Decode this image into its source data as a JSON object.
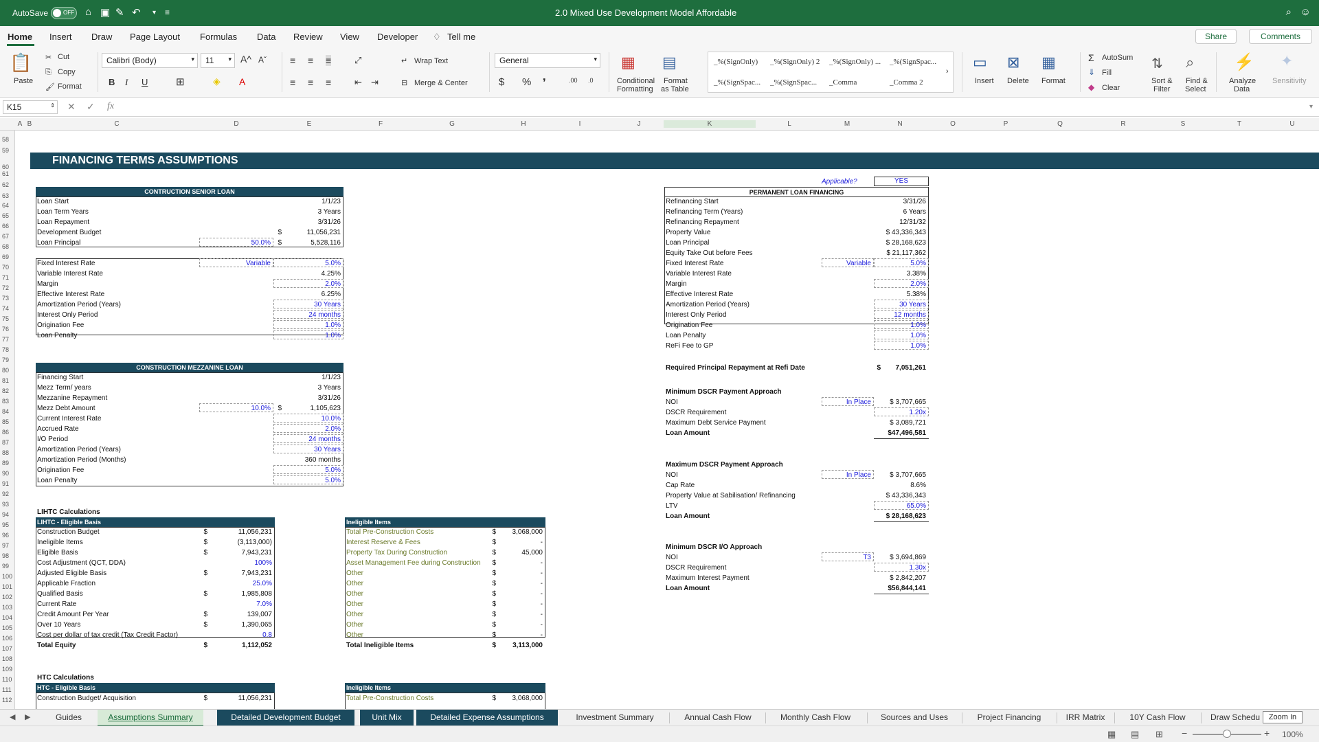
{
  "title_bar": {
    "autosave_label": "AutoSave",
    "toggle_label": "OFF",
    "doc_title": "2.0 Mixed Use Development Model Affordable"
  },
  "menu": {
    "items": [
      "Home",
      "Insert",
      "Draw",
      "Page Layout",
      "Formulas",
      "Data",
      "Review",
      "View",
      "Developer"
    ],
    "tell_me": "Tell me",
    "share": "Share",
    "comments": "Comments"
  },
  "ribbon": {
    "paste": "Paste",
    "cut": "Cut",
    "copy": "Copy",
    "format_painter": "Format",
    "font_name": "Calibri (Body)",
    "font_size": "11",
    "wrap_text": "Wrap Text",
    "merge_center": "Merge & Center",
    "number_format": "General",
    "conditional_formatting": [
      "Conditional",
      "Formatting"
    ],
    "format_as_table": [
      "Format",
      "as Table"
    ],
    "styles": [
      "_%(SignOnly)",
      "_%(SignOnly) 2",
      "_%(SignOnly) ...",
      "_%(SignSpac...",
      "_%(SignSpac...",
      "_%(SignSpac...",
      "_Comma",
      "_Comma 2"
    ],
    "insert": "Insert",
    "delete": "Delete",
    "format": "Format",
    "autosum": "AutoSum",
    "fill": "Fill",
    "clear": "Clear",
    "sort_filter": [
      "Sort &",
      "Filter"
    ],
    "find_select": [
      "Find &",
      "Select"
    ],
    "analyze_data": [
      "Analyze",
      "Data"
    ],
    "sensitivity": "Sensitivity"
  },
  "formula_bar": {
    "cell_ref": "K15",
    "fx": "fx"
  },
  "columns": [
    "A",
    "B",
    "C",
    "D",
    "E",
    "F",
    "G",
    "H",
    "I",
    "J",
    "K",
    "L",
    "M",
    "N",
    "O",
    "P",
    "Q",
    "R",
    "S",
    "T",
    "U"
  ],
  "rows": [
    "58",
    "59",
    "60",
    "61",
    "62",
    "63",
    "64",
    "65",
    "66",
    "67",
    "68",
    "69",
    "70",
    "71",
    "72",
    "73",
    "74",
    "75",
    "76",
    "77",
    "78",
    "79",
    "80",
    "81",
    "82",
    "83",
    "84",
    "85",
    "86",
    "87",
    "88",
    "89",
    "90",
    "91",
    "92",
    "93",
    "94",
    "95",
    "96",
    "97",
    "98",
    "99",
    "100",
    "101",
    "102",
    "103",
    "104",
    "105",
    "106",
    "107",
    "108",
    "109",
    "110",
    "111",
    "112"
  ],
  "banner": "FINANCING TERMS ASSUMPTIONS",
  "senior_loan": {
    "title": "CONTRUCTION SENIOR LOAN",
    "rows": [
      {
        "label": "Loan Start",
        "value": "1/1/23"
      },
      {
        "label": "Loan Term Years",
        "value": "3 Years"
      },
      {
        "label": "Loan Repayment",
        "value": "3/31/26"
      },
      {
        "label": "Development Budget",
        "value": "11,056,231"
      },
      {
        "label": "Loan Principal",
        "value": "5,528,116"
      }
    ],
    "dollar": "$",
    "pct": "50.0%",
    "rows2": [
      {
        "label": "Fixed Interest Rate",
        "value": "5.0%"
      },
      {
        "label": "Variable Interest Rate",
        "value": "4.25%"
      },
      {
        "label": "Margin",
        "value": "2.0%"
      },
      {
        "label": "Effective Interest Rate",
        "value": "6.25%"
      },
      {
        "label": "Amortization Period (Years)",
        "value": "30 Years"
      },
      {
        "label": "Interest Only Period",
        "value": "24 months"
      },
      {
        "label": "Origination Fee",
        "value": "1.0%"
      },
      {
        "label": "Loan Penalty",
        "value": "1.0%"
      }
    ],
    "variable": "Variable"
  },
  "mezz_loan": {
    "title": "CONSTRUCTION MEZZANINE LOAN",
    "rows": [
      {
        "label": "Financing Start",
        "value": "1/1/23"
      },
      {
        "label": "Mezz Term/ years",
        "value": "3 Years"
      },
      {
        "label": "Mezzanine Repayment",
        "value": "3/31/26"
      },
      {
        "label": "Mezz Debt Amount",
        "value": "1,105,623"
      },
      {
        "label": "Current Interest Rate",
        "value": "10.0%"
      },
      {
        "label": "Accrued Rate",
        "value": "2.0%"
      },
      {
        "label": "I/O Period",
        "value": "24 months"
      },
      {
        "label": "Amortization Period (Years)",
        "value": "30 Years"
      },
      {
        "label": "Amortization Period (Months)",
        "value": "360 months"
      },
      {
        "label": "Origination Fee",
        "value": "5.0%"
      },
      {
        "label": "Loan Penalty",
        "value": "5.0%"
      }
    ],
    "pct": "10.0%",
    "dollar": "$"
  },
  "lihtc": {
    "heading": "LIHTC Calculations",
    "title": "LIHTC - Eligible Basis",
    "rows": [
      {
        "label": "Construction Budget",
        "dollar": "$",
        "value": "11,056,231"
      },
      {
        "label": "Ineligible Items",
        "dollar": "$",
        "value": "(3,113,000)"
      },
      {
        "label": "Eligible Basis",
        "dollar": "$",
        "value": "7,943,231"
      },
      {
        "label": "Cost Adjustment (QCT, DDA)",
        "dollar": "",
        "value": "100%"
      },
      {
        "label": "Adjusted Eligible Basis",
        "dollar": "$",
        "value": "7,943,231"
      },
      {
        "label": "Applicable Fraction",
        "dollar": "",
        "value": "25.0%"
      },
      {
        "label": "Qualified Basis",
        "dollar": "$",
        "value": "1,985,808"
      },
      {
        "label": "Current Rate",
        "dollar": "",
        "value": "7.0%"
      },
      {
        "label": "Credit Amount Per Year",
        "dollar": "$",
        "value": "139,007"
      },
      {
        "label": "Over 10 Years",
        "dollar": "$",
        "value": "1,390,065"
      },
      {
        "label": "Cost per dollar of tax credit (Tax Credit Factor)",
        "dollar": "",
        "value": "0.8"
      },
      {
        "label": "Total Equity",
        "dollar": "$",
        "value": "1,112,052"
      }
    ]
  },
  "ineligible": {
    "title": "Ineligible Items",
    "rows": [
      {
        "label": "Total Pre-Construction Costs",
        "dollar": "$",
        "value": "3,068,000"
      },
      {
        "label": "Interest Reserve & Fees",
        "dollar": "$",
        "value": "-"
      },
      {
        "label": "Property Tax During Construction",
        "dollar": "$",
        "value": "45,000"
      },
      {
        "label": "Asset Management Fee during Construction",
        "dollar": "$",
        "value": "-"
      },
      {
        "label": "Other",
        "dollar": "$",
        "value": "-"
      },
      {
        "label": "Other",
        "dollar": "$",
        "value": "-"
      },
      {
        "label": "Other",
        "dollar": "$",
        "value": "-"
      },
      {
        "label": "Other",
        "dollar": "$",
        "value": "-"
      },
      {
        "label": "Other",
        "dollar": "$",
        "value": "-"
      },
      {
        "label": "Other",
        "dollar": "$",
        "value": "-"
      },
      {
        "label": "Other",
        "dollar": "$",
        "value": "-"
      },
      {
        "label": "Total Ineligible Items",
        "dollar": "$",
        "value": "3,113,000"
      }
    ]
  },
  "htc": {
    "heading": "HTC Calculations",
    "title": "HTC - Eligible Basis",
    "row1_label": "Construction Budget/ Acquisition",
    "row1_dollar": "$",
    "row1_value": "11,056,231",
    "inel_title": "Ineligible Items",
    "inel_row1_label": "Total Pre-Construction Costs",
    "inel_row1_dollar": "$",
    "inel_row1_value": "3,068,000"
  },
  "perm_loan": {
    "applicable_label": "Applicable?",
    "applicable_value": "YES",
    "title": "PERMANENT LOAN FINANCING",
    "rows": [
      {
        "label": "Refinancing Start",
        "value": "3/31/26"
      },
      {
        "label": "Refinancing Term (Years)",
        "value": "6 Years"
      },
      {
        "label": "Refinancing Repayment",
        "value": "12/31/32"
      },
      {
        "label": "Property Value",
        "value": "$ 43,336,343"
      },
      {
        "label": "Loan Principal",
        "value": "$ 28,168,623"
      },
      {
        "label": "Equity Take Out before Fees",
        "value": "$ 21,117,362"
      },
      {
        "label": "Fixed Interest Rate",
        "value": "5.0%"
      },
      {
        "label": "Variable Interest Rate",
        "value": "3.38%"
      },
      {
        "label": "Margin",
        "value": "2.0%"
      },
      {
        "label": "Effective Interest Rate",
        "value": "5.38%"
      },
      {
        "label": "Amortization Period (Years)",
        "value": "30 Years"
      },
      {
        "label": "Interest Only Period",
        "value": "12 months"
      },
      {
        "label": "Origination Fee",
        "value": "1.0%"
      },
      {
        "label": "Loan Penalty",
        "value": "1.0%"
      },
      {
        "label": "ReFi Fee to GP",
        "value": "1.0%"
      }
    ],
    "variable": "Variable"
  },
  "required_principal": {
    "label": "Required Principal Repayment at Refi Date",
    "dollar": "$",
    "value": "7,051,261"
  },
  "min_dscr": {
    "title": "Minimum DSCR Payment Approach",
    "rows": [
      {
        "label": "NOI",
        "tag": "In Place",
        "value": "$ 3,707,665"
      },
      {
        "label": "DSCR Requirement",
        "tag": "",
        "value": "1.20x"
      },
      {
        "label": "Maximum Debt Service Payment",
        "tag": "",
        "value": "$ 3,089,721"
      },
      {
        "label": "Loan Amount",
        "tag": "",
        "value": "$47,496,581"
      }
    ]
  },
  "max_dscr": {
    "title": "Maximum DSCR Payment Approach",
    "rows": [
      {
        "label": "NOI",
        "tag": "In Place",
        "value": "$ 3,707,665"
      },
      {
        "label": "Cap Rate",
        "tag": "",
        "value": "8.6%"
      },
      {
        "label": "Property Value at Sabilisation/ Refinancing",
        "tag": "",
        "value": "$ 43,336,343"
      },
      {
        "label": "LTV",
        "tag": "",
        "value": "65.0%"
      },
      {
        "label": "Loan Amount",
        "tag": "",
        "value": "$ 28,168,623"
      }
    ]
  },
  "min_dscr_io": {
    "title": "Minimum DSCR I/O Approach",
    "rows": [
      {
        "label": "NOI",
        "tag": "T3",
        "value": "$ 3,694,869"
      },
      {
        "label": "DSCR Requirement",
        "tag": "",
        "value": "1.30x"
      },
      {
        "label": "Maximum Interest Payment",
        "tag": "",
        "value": "$ 2,842,207"
      },
      {
        "label": "Loan Amount",
        "tag": "",
        "value": "$56,844,141"
      }
    ]
  },
  "tabs": [
    "Guides",
    "Assumptions Summary",
    "Detailed Development Budget",
    "Unit Mix",
    "Detailed Expense Assumptions",
    "Investment Summary",
    "Annual Cash Flow",
    "Monthly Cash Flow",
    "Sources and Uses",
    "Project Financing",
    "IRR Matrix",
    "10Y Cash Flow",
    "Draw Schedu"
  ],
  "tooltip": "Zoom In",
  "zoom": "100%"
}
